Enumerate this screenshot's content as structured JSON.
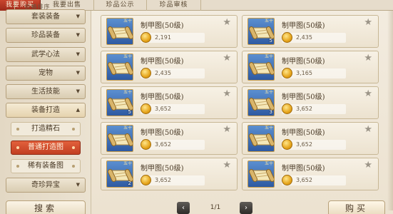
{
  "tabs": [
    {
      "label": "我要购买",
      "active": true
    },
    {
      "label": "我要出售",
      "active": false
    },
    {
      "label": "珍品公示",
      "active": false
    },
    {
      "label": "珍品审核",
      "active": false
    }
  ],
  "price_sort_label": "价格排序",
  "sidebar": {
    "categories": [
      {
        "label": "套装装备",
        "arrow": "▼"
      },
      {
        "label": "珍品装备",
        "arrow": "▼"
      },
      {
        "label": "武学心法",
        "arrow": "▼"
      },
      {
        "label": "宠物",
        "arrow": "▼"
      },
      {
        "label": "生活技能",
        "arrow": "▼"
      },
      {
        "label": "装备打造",
        "arrow": "▲"
      }
    ],
    "subitems": [
      {
        "label": "打造精石",
        "active": false
      },
      {
        "label": "普通打造图",
        "active": true
      },
      {
        "label": "稀有装备图",
        "active": false
      }
    ],
    "last_category": {
      "label": "奇珍异宝",
      "arrow": "▼"
    }
  },
  "listings": [
    {
      "name": "制甲图(50级)",
      "price": "2,191",
      "qty": ""
    },
    {
      "name": "制甲图(50级)",
      "price": "2,435",
      "qty": "5"
    },
    {
      "name": "制甲图(50级)",
      "price": "2,435",
      "qty": ""
    },
    {
      "name": "制甲图(50级)",
      "price": "3,165",
      "qty": ""
    },
    {
      "name": "制甲图(50级)",
      "price": "3,652",
      "qty": "5"
    },
    {
      "name": "制甲图(50级)",
      "price": "3,652",
      "qty": "3"
    },
    {
      "name": "制甲图(50级)",
      "price": "3,652",
      "qty": ""
    },
    {
      "name": "制甲图(50级)",
      "price": "3,652",
      "qty": ""
    },
    {
      "name": "制甲图(50级)",
      "price": "3,652",
      "qty": "2"
    },
    {
      "name": "制甲图(50级)",
      "price": "3,652",
      "qty": ""
    }
  ],
  "item_badge": "五十",
  "star_glyph": "★",
  "pager": {
    "prev": "‹",
    "text": "1/1",
    "next": "›"
  },
  "search_label": "搜索",
  "buy_label": "购买",
  "colors": {
    "active_tab": "#b3331f",
    "active_sub": "#d24f2e",
    "coin": "#e6a51c"
  }
}
